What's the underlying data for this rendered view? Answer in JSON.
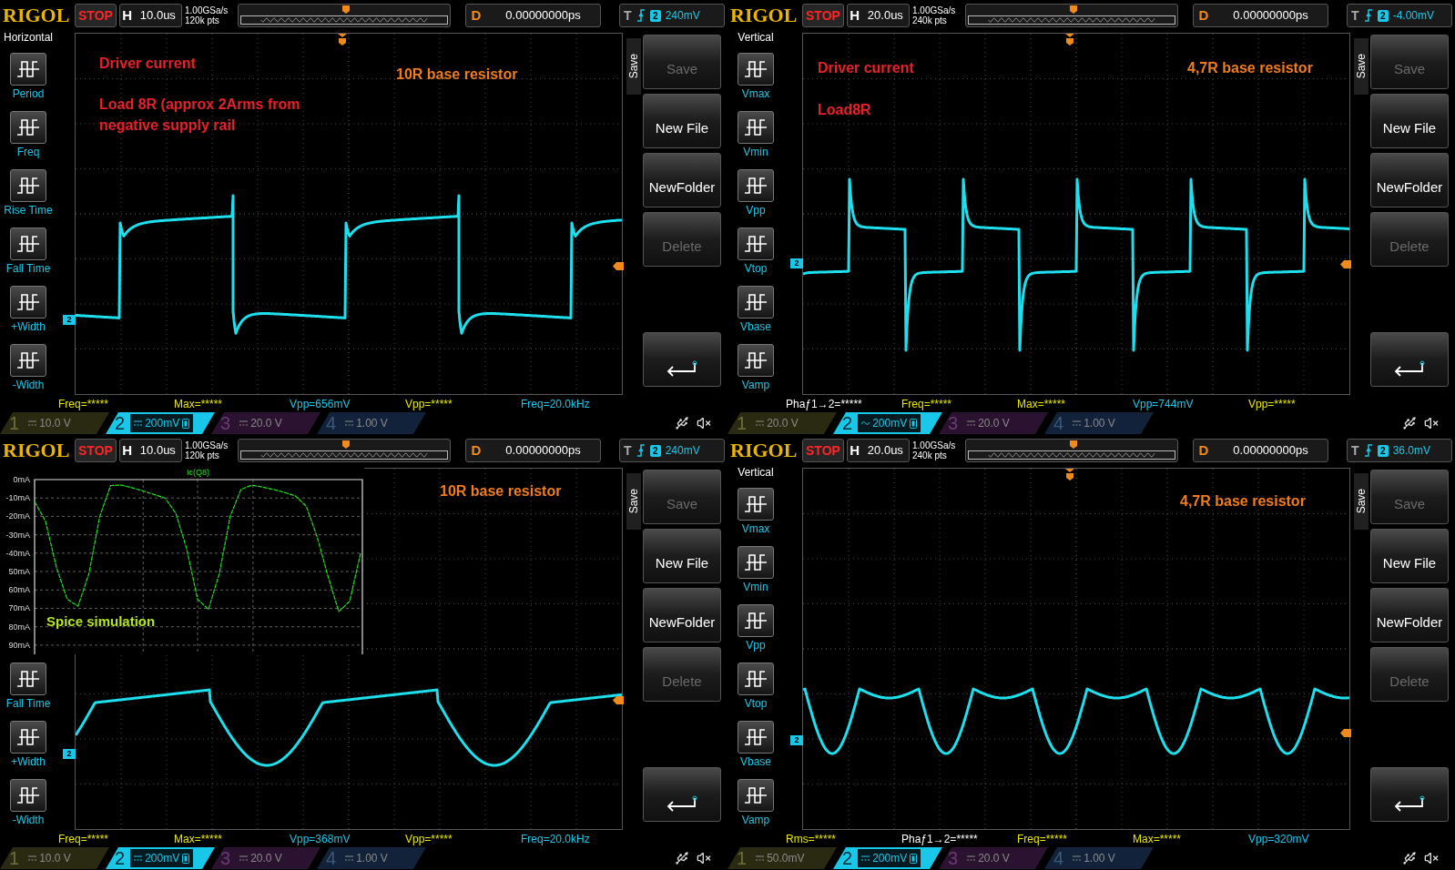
{
  "panels": [
    {
      "header": {
        "brand": "RIGOL",
        "run_state": "STOP",
        "timebase_label": "H",
        "timebase": "10.0us",
        "sample_rate": "1.00GSa/s",
        "memory_depth": "120k pts",
        "delay_label": "D",
        "delay": "0.00000000ps",
        "trigger_label": "T",
        "trigger_source": "2",
        "trigger_level": "240mV"
      },
      "left_menu": {
        "title": "Horizontal",
        "items": [
          {
            "label": "Period"
          },
          {
            "label": "Freq"
          },
          {
            "label": "Rise Time"
          },
          {
            "label": "Fall Time"
          },
          {
            "label": "+Width"
          },
          {
            "label": "-Width"
          }
        ]
      },
      "annotations": [
        {
          "text": "Driver current",
          "color": "#e8202a"
        },
        {
          "text": "Load 8R (approx 2Arms from\nnegative supply rail",
          "color": "#e8202a"
        },
        {
          "text": "10R base resistor",
          "color": "#f07c1a"
        }
      ],
      "trace": {
        "kind": "square",
        "channel_marker": "2"
      },
      "softkeys": {
        "title": "Save",
        "buttons": [
          {
            "kind": "text",
            "label": "Save",
            "disabled": true
          },
          {
            "kind": "text",
            "label": "New File",
            "disabled": false
          },
          {
            "kind": "text",
            "label": "NewFolder",
            "disabled": false
          },
          {
            "kind": "text",
            "label": "Delete",
            "disabled": true
          },
          {
            "kind": "return"
          }
        ]
      },
      "measurements": [
        {
          "text": "Freq=*****",
          "color": "#e8e800"
        },
        {
          "text": "Max=*****",
          "color": "#e8e800"
        },
        {
          "text": "Vpp=656mV",
          "color": "#19c8e8"
        },
        {
          "text": "Vpp=*****",
          "color": "#e8e800"
        },
        {
          "text": "Freq=20.0kHz",
          "color": "#19c8e8"
        }
      ],
      "channels": [
        {
          "number": "1",
          "ac_coupled": false,
          "scale": "10.0 V",
          "selected": false,
          "bw_limit": false
        },
        {
          "number": "2",
          "ac_coupled": false,
          "scale": "200mV",
          "selected": true,
          "bw_limit": true
        },
        {
          "number": "3",
          "ac_coupled": false,
          "scale": "20.0 V",
          "selected": false,
          "bw_limit": false
        },
        {
          "number": "4",
          "ac_coupled": false,
          "scale": "1.00 V",
          "selected": false,
          "bw_limit": false
        }
      ]
    },
    {
      "header": {
        "brand": "RIGOL",
        "run_state": "STOP",
        "timebase_label": "H",
        "timebase": "20.0us",
        "sample_rate": "1.00GSa/s",
        "memory_depth": "240k pts",
        "delay_label": "D",
        "delay": "0.00000000ps",
        "trigger_label": "T",
        "trigger_source": "2",
        "trigger_level": "-4.00mV"
      },
      "left_menu": {
        "title": "Vertical",
        "items": [
          {
            "label": "Vmax"
          },
          {
            "label": "Vmin"
          },
          {
            "label": "Vpp"
          },
          {
            "label": "Vtop"
          },
          {
            "label": "Vbase"
          },
          {
            "label": "Vamp"
          }
        ]
      },
      "annotations": [
        {
          "text": "Driver current",
          "color": "#e8202a"
        },
        {
          "text": "Load8R",
          "color": "#e8202a"
        },
        {
          "text": "4,7R base resistor",
          "color": "#f07c1a"
        }
      ],
      "trace": {
        "kind": "spikes",
        "channel_marker": "2"
      },
      "softkeys": {
        "title": "Save",
        "buttons": [
          {
            "kind": "text",
            "label": "Save",
            "disabled": true
          },
          {
            "kind": "text",
            "label": "New File",
            "disabled": false
          },
          {
            "kind": "text",
            "label": "NewFolder",
            "disabled": false
          },
          {
            "kind": "text",
            "label": "Delete",
            "disabled": true
          },
          {
            "kind": "return"
          }
        ]
      },
      "measurements": [
        {
          "text": "Phaƒ1→2=*****",
          "color": "#ffffff"
        },
        {
          "text": "Freq=*****",
          "color": "#e8e800"
        },
        {
          "text": "Max=*****",
          "color": "#e8e800"
        },
        {
          "text": "Vpp=744mV",
          "color": "#19c8e8"
        },
        {
          "text": "Vpp=*****",
          "color": "#e8e800"
        }
      ],
      "channels": [
        {
          "number": "1",
          "ac_coupled": false,
          "scale": "20.0 V",
          "selected": false,
          "bw_limit": false
        },
        {
          "number": "2",
          "ac_coupled": true,
          "scale": "200mV",
          "selected": true,
          "bw_limit": true
        },
        {
          "number": "3",
          "ac_coupled": false,
          "scale": "20.0 V",
          "selected": false,
          "bw_limit": false
        },
        {
          "number": "4",
          "ac_coupled": false,
          "scale": "1.00 V",
          "selected": false,
          "bw_limit": false
        }
      ]
    },
    {
      "header": {
        "brand": "RIGOL",
        "run_state": "STOP",
        "timebase_label": "H",
        "timebase": "10.0us",
        "sample_rate": "1.00GSa/s",
        "memory_depth": "120k pts",
        "delay_label": "D",
        "delay": "0.00000000ps",
        "trigger_label": "T",
        "trigger_source": "2",
        "trigger_level": "240mV"
      },
      "left_menu": {
        "items": [
          {
            "label": "Fall Time"
          },
          {
            "label": "+Width"
          },
          {
            "label": "-Width"
          }
        ]
      },
      "annotations": [
        {
          "text": "10R base resistor",
          "color": "#f07c1a"
        }
      ],
      "inset": {
        "caption": "Spice simulation",
        "chart_data": {
          "type": "line",
          "grid": true,
          "series": [
            {
              "name": "Ic(Q8)",
              "color": "#22e022",
              "line_style": "dashed",
              "values": [
                -12,
                -22.5,
                -47.5,
                -65,
                -68.8,
                -51.1,
                -20,
                -3.2,
                -3,
                -4.5,
                -6.2,
                -8.1,
                -10,
                -18.3,
                -37.8,
                -65,
                -70.6,
                -51.1,
                -20,
                -5.3,
                -3,
                -4.1,
                -5.4,
                -7,
                -8.9,
                -14.4,
                -31.1,
                -52.5,
                -71.7,
                -66.1,
                -40
              ]
            }
          ],
          "ylim": [
            -94,
            0
          ],
          "yticks": [
            {
              "value": 0,
              "label": "0mA"
            },
            {
              "value": -10,
              "label": "-10mA"
            },
            {
              "value": -20,
              "label": "-20mA"
            },
            {
              "value": -30,
              "label": "-30mA"
            },
            {
              "value": -40,
              "label": "-40mA"
            },
            {
              "value": -50,
              "label": "50mA"
            },
            {
              "value": -60,
              "label": "60mA"
            },
            {
              "value": -70,
              "label": "70mA"
            },
            {
              "value": -80,
              "label": "80mA"
            },
            {
              "value": -90,
              "label": "90mA"
            }
          ]
        }
      },
      "trace": {
        "kind": "clipped",
        "channel_marker": "2"
      },
      "softkeys": {
        "title": "Save",
        "buttons": [
          {
            "kind": "text",
            "label": "Save",
            "disabled": true
          },
          {
            "kind": "text",
            "label": "New File",
            "disabled": false
          },
          {
            "kind": "text",
            "label": "NewFolder",
            "disabled": false
          },
          {
            "kind": "text",
            "label": "Delete",
            "disabled": true
          },
          {
            "kind": "return"
          }
        ]
      },
      "measurements": [
        {
          "text": "Freq=*****",
          "color": "#e8e800"
        },
        {
          "text": "Max=*****",
          "color": "#e8e800"
        },
        {
          "text": "Vpp=368mV",
          "color": "#19c8e8"
        },
        {
          "text": "Vpp=*****",
          "color": "#e8e800"
        },
        {
          "text": "Freq=20.0kHz",
          "color": "#19c8e8"
        }
      ],
      "channels": [
        {
          "number": "1",
          "ac_coupled": false,
          "scale": "10.0 V",
          "selected": false,
          "bw_limit": false
        },
        {
          "number": "2",
          "ac_coupled": false,
          "scale": "200mV",
          "selected": true,
          "bw_limit": true
        },
        {
          "number": "3",
          "ac_coupled": false,
          "scale": "20.0 V",
          "selected": false,
          "bw_limit": false
        },
        {
          "number": "4",
          "ac_coupled": false,
          "scale": "1.00 V",
          "selected": false,
          "bw_limit": false
        }
      ]
    },
    {
      "header": {
        "brand": "RIGOL",
        "run_state": "STOP",
        "timebase_label": "H",
        "timebase": "20.0us",
        "sample_rate": "1.00GSa/s",
        "memory_depth": "240k pts",
        "delay_label": "D",
        "delay": "0.00000000ps",
        "trigger_label": "T",
        "trigger_source": "2",
        "trigger_level": "36.0mV"
      },
      "left_menu": {
        "title": "Vertical",
        "items": [
          {
            "label": "Vmax"
          },
          {
            "label": "Vmin"
          },
          {
            "label": "Vpp"
          },
          {
            "label": "Vtop"
          },
          {
            "label": "Vbase"
          },
          {
            "label": "Vamp"
          }
        ]
      },
      "annotations": [
        {
          "text": "4,7R base resistor",
          "color": "#f07c1a"
        }
      ],
      "trace": {
        "kind": "scallop",
        "channel_marker": "2"
      },
      "softkeys": {
        "title": "Save",
        "buttons": [
          {
            "kind": "text",
            "label": "Save",
            "disabled": true
          },
          {
            "kind": "text",
            "label": "New File",
            "disabled": false
          },
          {
            "kind": "text",
            "label": "NewFolder",
            "disabled": false
          },
          {
            "kind": "text",
            "label": "Delete",
            "disabled": true
          },
          {
            "kind": "return"
          }
        ]
      },
      "measurements": [
        {
          "text": "Rms=*****",
          "color": "#e8e800"
        },
        {
          "text": "Phaƒ1→2=*****",
          "color": "#ffffff"
        },
        {
          "text": "Freq=*****",
          "color": "#e8e800"
        },
        {
          "text": "Max=*****",
          "color": "#e8e800"
        },
        {
          "text": "Vpp=320mV",
          "color": "#19c8e8"
        }
      ],
      "channels": [
        {
          "number": "1",
          "ac_coupled": false,
          "scale": "50.0mV",
          "selected": false,
          "bw_limit": false
        },
        {
          "number": "2",
          "ac_coupled": false,
          "scale": "200mV",
          "selected": true,
          "bw_limit": true
        },
        {
          "number": "3",
          "ac_coupled": false,
          "scale": "20.0 V",
          "selected": false,
          "bw_limit": false
        },
        {
          "number": "4",
          "ac_coupled": false,
          "scale": "1.00 V",
          "selected": false,
          "bw_limit": false
        }
      ]
    }
  ]
}
